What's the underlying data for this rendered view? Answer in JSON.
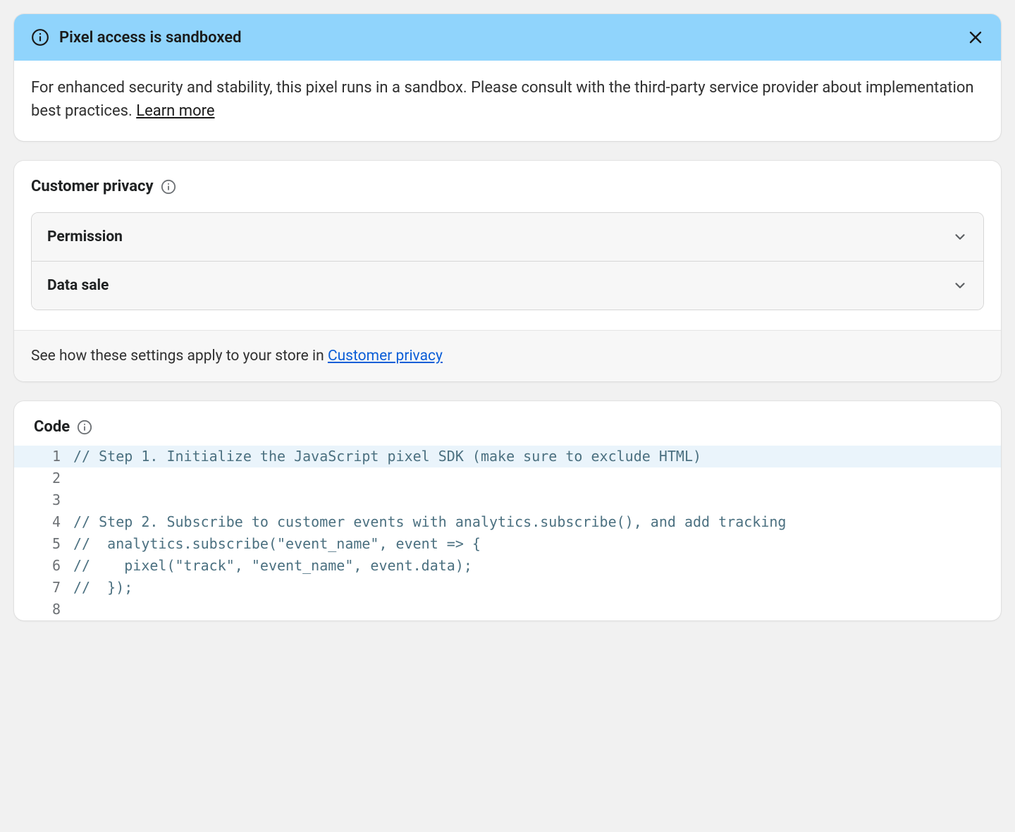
{
  "banner": {
    "title": "Pixel access is sandboxed",
    "body_prefix": "For enhanced security and stability, this pixel runs in a sandbox. Please consult with the third-party service provider about implementation best practices. ",
    "learn_more": "Learn more"
  },
  "privacy": {
    "title": "Customer privacy",
    "items": [
      {
        "label": "Permission"
      },
      {
        "label": "Data sale"
      }
    ],
    "footer_prefix": "See how these settings apply to your store in ",
    "footer_link": "Customer privacy"
  },
  "code": {
    "title": "Code",
    "lines": [
      {
        "n": "1",
        "text": "// Step 1. Initialize the JavaScript pixel SDK (make sure to exclude HTML)",
        "hl": true
      },
      {
        "n": "2",
        "text": ""
      },
      {
        "n": "3",
        "text": ""
      },
      {
        "n": "4",
        "text": "// Step 2. Subscribe to customer events with analytics.subscribe(), and add tracking"
      },
      {
        "n": "5",
        "text": "//  analytics.subscribe(\"event_name\", event => {"
      },
      {
        "n": "6",
        "text": "//    pixel(\"track\", \"event_name\", event.data);"
      },
      {
        "n": "7",
        "text": "//  });"
      },
      {
        "n": "8",
        "text": ""
      }
    ]
  }
}
